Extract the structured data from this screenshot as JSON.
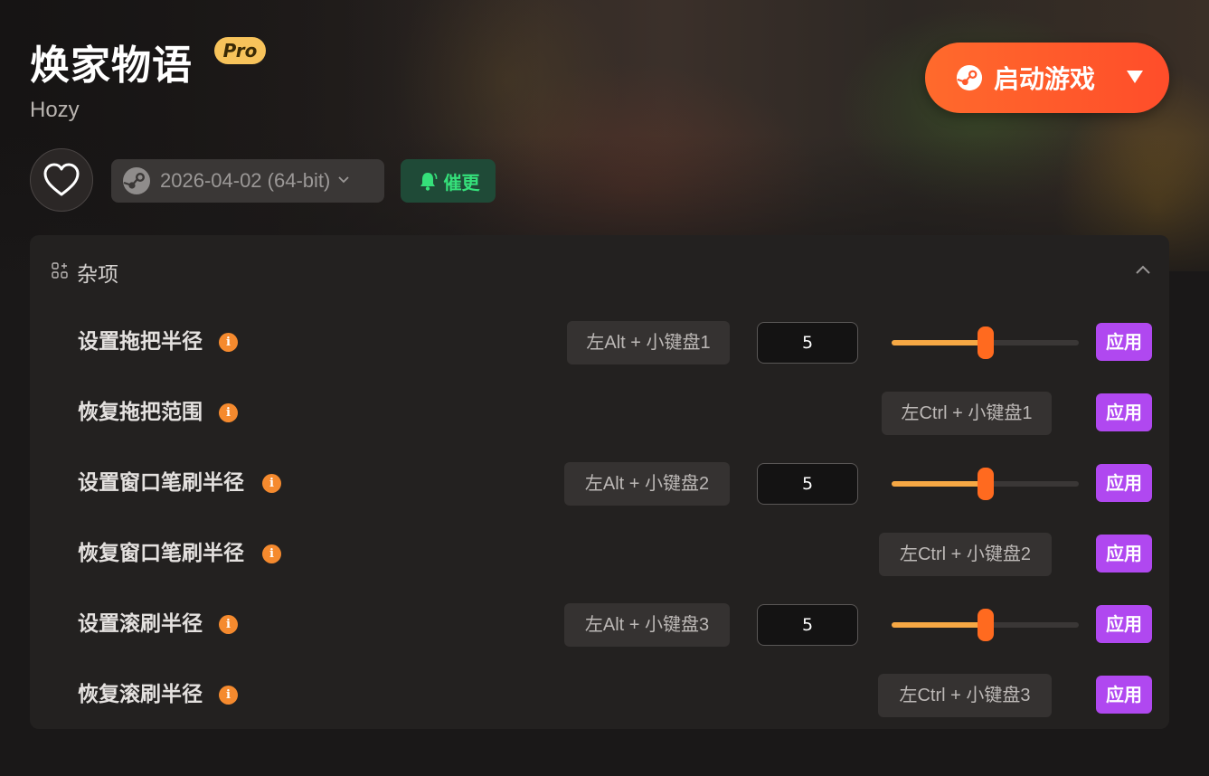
{
  "game": {
    "title": "焕家物语",
    "badge": "Pro",
    "subtitle": "Hozy",
    "version": "2026-04-02 (64-bit)",
    "remind_label": "催更",
    "launch_label": "启动游戏"
  },
  "panel": {
    "title": "杂项",
    "rows": [
      {
        "label": "设置拖把半径",
        "hotkey": "左Alt + 小键盘1",
        "value": "5",
        "slider_fraction": 0.5,
        "apply": "应用"
      },
      {
        "label": "恢复拖把范围",
        "hotkey": "左Ctrl + 小键盘1",
        "apply": "应用"
      },
      {
        "label": "设置窗口笔刷半径",
        "hotkey": "左Alt + 小键盘2",
        "value": "5",
        "slider_fraction": 0.5,
        "apply": "应用"
      },
      {
        "label": "恢复窗口笔刷半径",
        "hotkey": "左Ctrl + 小键盘2",
        "apply": "应用"
      },
      {
        "label": "设置滚刷半径",
        "hotkey": "左Alt + 小键盘3",
        "value": "5",
        "slider_fraction": 0.5,
        "apply": "应用"
      },
      {
        "label": "恢复滚刷半径",
        "hotkey": "左Ctrl + 小键盘3",
        "apply": "应用"
      }
    ]
  },
  "colors": {
    "accent_orange": "#ff6a2c",
    "apply_purple": "#b048f0",
    "remind_green": "#35e07a",
    "info_orange": "#f58a2e",
    "badge_gold": "#f7c35b"
  },
  "icons": {
    "favorite": "heart-icon",
    "platform": "steam-icon",
    "remind": "bell-icon",
    "dropdown": "chevron-down-icon",
    "launch_dropdown": "triangle-down-icon",
    "section": "apps-grid-icon",
    "collapse": "chevron-up-icon",
    "info": "info-icon"
  }
}
